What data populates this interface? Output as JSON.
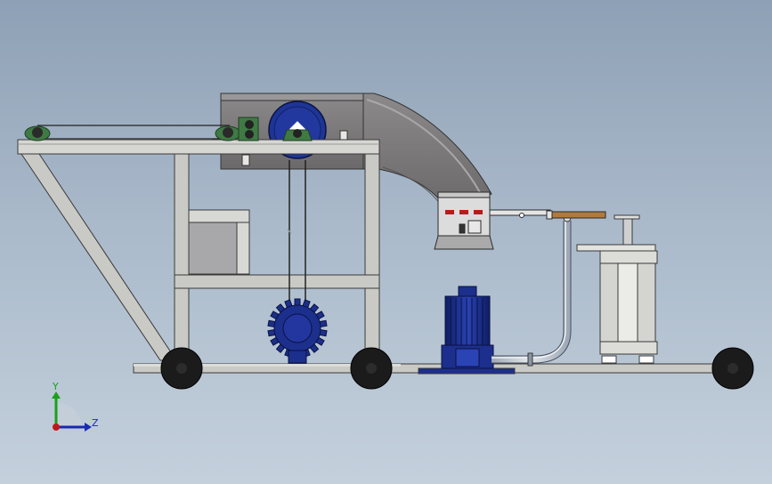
{
  "triad": {
    "y_label": "Y",
    "z_label": "Z",
    "y_color": "#1aa01a",
    "z_color": "#1a2ab0",
    "origin_color": "#c01818"
  },
  "colors": {
    "background_top": "#8ea0b5",
    "background_bottom": "#c4d0dc",
    "frame": "#c9c9c6",
    "frame_edge": "#3a3a3a",
    "motor_blue": "#1c2f8c",
    "bearing_green": "#3f7a44",
    "wheel": "#1b1b1b",
    "hopper": "#7d7a7c",
    "wood_handle": "#b07a3c",
    "panel_red": "#c01818"
  },
  "parts": [
    "base-frame",
    "a-frame-support",
    "conveyor-belt",
    "hopper-chute",
    "pulley-disk",
    "drive-sprocket",
    "electric-motor",
    "pipe",
    "hand-lever",
    "press-stand",
    "control-box",
    "wheels"
  ]
}
